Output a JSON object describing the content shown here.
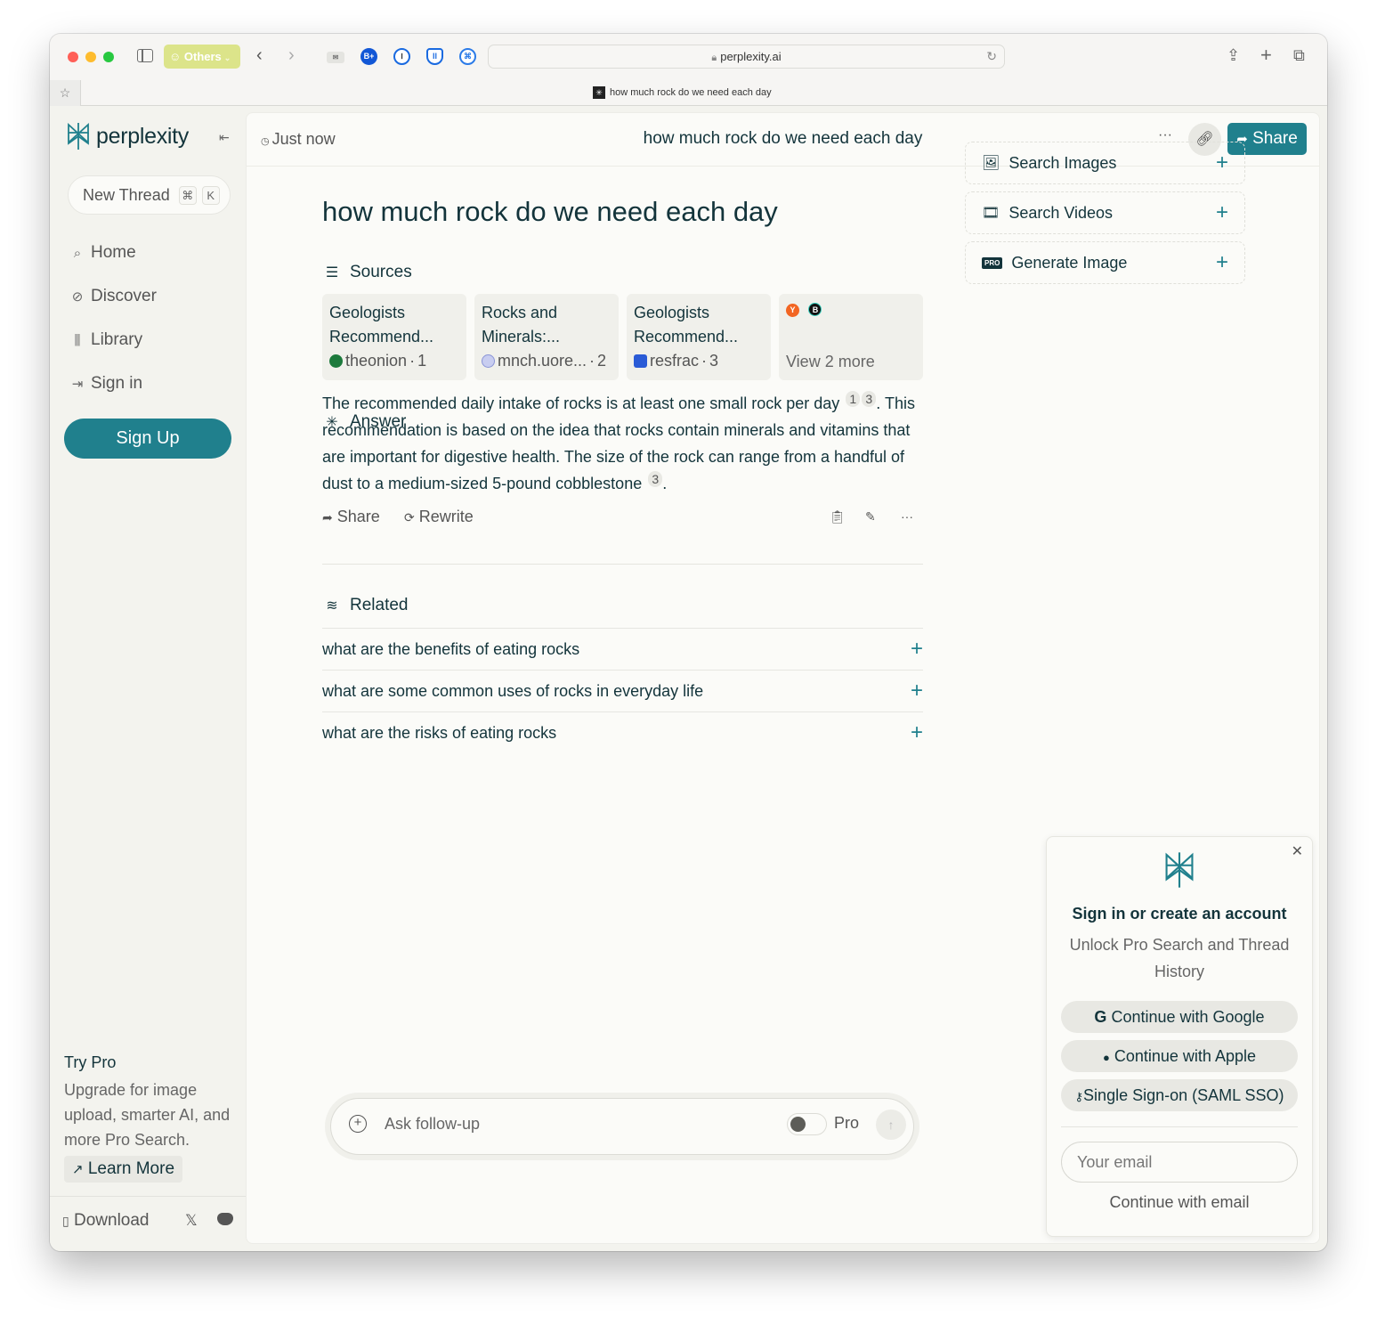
{
  "browser": {
    "tab_group_label": "Others",
    "url": "perplexity.ai",
    "tab_title": "how much rock do we need each day",
    "extensions": [
      "mail-extension-icon",
      "b-plus-extension-icon",
      "1password-icon",
      "bitwarden-icon",
      "command-extension-icon"
    ]
  },
  "sidebar": {
    "logo_text": "perplexity",
    "new_thread_label": "New Thread",
    "new_thread_shortcut": [
      "⌘",
      "K"
    ],
    "nav": [
      {
        "label": "Home",
        "icon": "search-icon"
      },
      {
        "label": "Discover",
        "icon": "compass-icon"
      },
      {
        "label": "Library",
        "icon": "library-icon"
      },
      {
        "label": "Sign in",
        "icon": "sign-in-icon"
      }
    ],
    "signup_label": "Sign Up",
    "try_pro": {
      "title": "Try Pro",
      "description": "Upgrade for image upload, smarter AI, and more Pro Search.",
      "learn_more_label": "Learn More"
    },
    "download_label": "Download"
  },
  "topbar": {
    "timestamp": "Just now",
    "title": "how much rock do we need each day",
    "more_label": "···",
    "share_label": "Share"
  },
  "thread": {
    "question": "how much rock do we need each day",
    "sources_heading": "Sources",
    "sources": [
      {
        "title": "Geologists Recommend...",
        "site": "theonion",
        "index": "1",
        "fav_color": "#1d7a3c"
      },
      {
        "title": "Rocks and Minerals:...",
        "site": "mnch.uore...",
        "index": "2",
        "fav_color": "#8a94d6"
      },
      {
        "title": "Geologists Recommend...",
        "site": "resfrac",
        "index": "3",
        "fav_color": "#2a5bd6"
      }
    ],
    "view_more_label": "View 2 more",
    "answer_heading": "Answer",
    "answer_parts": {
      "s1": "The recommended daily intake of rocks is at least one small rock per day",
      "c1": "1",
      "c2": "3",
      "s2": ". This recommendation is based on the idea that rocks contain minerals and vitamins that are important for digestive health. The size of the rock can range from a handful of dust to a medium-sized 5-pound cobblestone",
      "c3": "3",
      "s3": "."
    },
    "actions": {
      "share": "Share",
      "rewrite": "Rewrite"
    },
    "related_heading": "Related",
    "related": [
      "what are the benefits of eating rocks",
      "what are some common uses of rocks in everyday life",
      "what are the risks of eating rocks"
    ],
    "followup_placeholder": "Ask follow-up",
    "pro_toggle_label": "Pro"
  },
  "right_panel": {
    "cards": [
      {
        "label": "Search Images",
        "icon": "image-icon"
      },
      {
        "label": "Search Videos",
        "icon": "film-icon"
      },
      {
        "label": "Generate Image",
        "icon": "pro-badge-icon",
        "badge": "PRO"
      }
    ]
  },
  "signin_popup": {
    "title": "Sign in or create an account",
    "subtitle": "Unlock Pro Search and Thread History",
    "google_label": "Continue with Google",
    "apple_label": "Continue with Apple",
    "sso_label": "Single Sign-on (SAML SSO)",
    "email_placeholder": "Your email",
    "continue_email_label": "Continue with email"
  },
  "colors": {
    "brand": "#20808d",
    "text": "#13343b",
    "sidebar_bg": "#f3f3ee",
    "main_bg": "#fbfbf8"
  }
}
